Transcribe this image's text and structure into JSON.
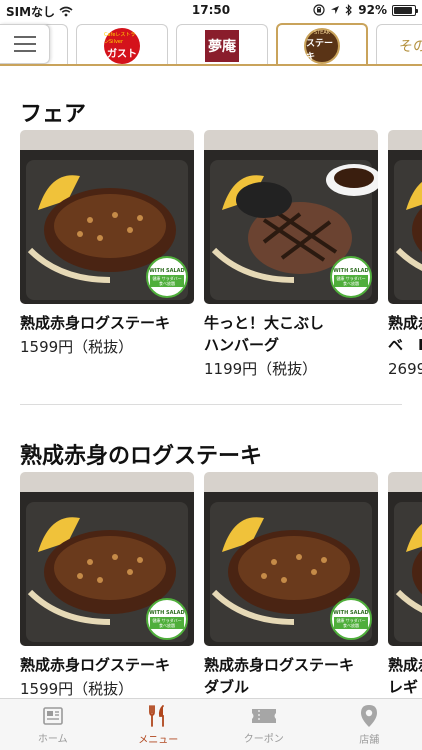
{
  "status_bar": {
    "carrier": "SIMなし",
    "time": "17:50",
    "battery": "92%",
    "battery_level": 0.92
  },
  "brand_tabs": [
    {
      "name": "gusto",
      "logo_sub": "CafeレストランSilver",
      "logo_text": "ガスト"
    },
    {
      "name": "yumean",
      "logo_text": "夢庵"
    },
    {
      "name": "steak-gusto",
      "logo_sub": "STEAK",
      "logo_text": "ステーキ",
      "active": true
    },
    {
      "name": "other",
      "label": "その"
    }
  ],
  "sections": [
    {
      "title": "フェア",
      "items": [
        {
          "name": "熟成赤身ログステーキ",
          "price": "1599円（税抜）",
          "badge_top": "WITH SALAD",
          "badge_bottom": "健康 サラダバー 食べ放題"
        },
        {
          "name": "牛っと！大こぶし\nハンバーグ",
          "price": "1199円（税抜）",
          "badge_top": "WITH SALAD",
          "badge_bottom": "健康 サラダバー 食べ放題"
        },
        {
          "name": "熟成赤\nベ　I",
          "price": "2699"
        }
      ]
    },
    {
      "title": "熟成赤身のログステーキ",
      "items": [
        {
          "name": "熟成赤身ログステーキ",
          "price": "1599円（税抜）",
          "badge_top": "WITH SALAD",
          "badge_bottom": "健康 サラダバー 食べ放題"
        },
        {
          "name": "熟成赤身ログステーキ\nダブル",
          "price": "",
          "badge_top": "WITH SALAD",
          "badge_bottom": "健康 サラダバー 食べ放題"
        },
        {
          "name": "熟成赤\nレギ",
          "price": ""
        }
      ]
    }
  ],
  "bottom_tabs": [
    {
      "label": "ホーム",
      "icon": "newspaper-icon",
      "active": false
    },
    {
      "label": "メニュー",
      "icon": "fork-knife-icon",
      "active": true
    },
    {
      "label": "クーポン",
      "icon": "ticket-icon",
      "active": false
    },
    {
      "label": "店舗",
      "icon": "map-pin-icon",
      "active": false
    }
  ],
  "colors": {
    "accent_gold": "#c9a35b",
    "active_tab": "#b0461d",
    "inactive_tab": "#9a9a9a"
  }
}
